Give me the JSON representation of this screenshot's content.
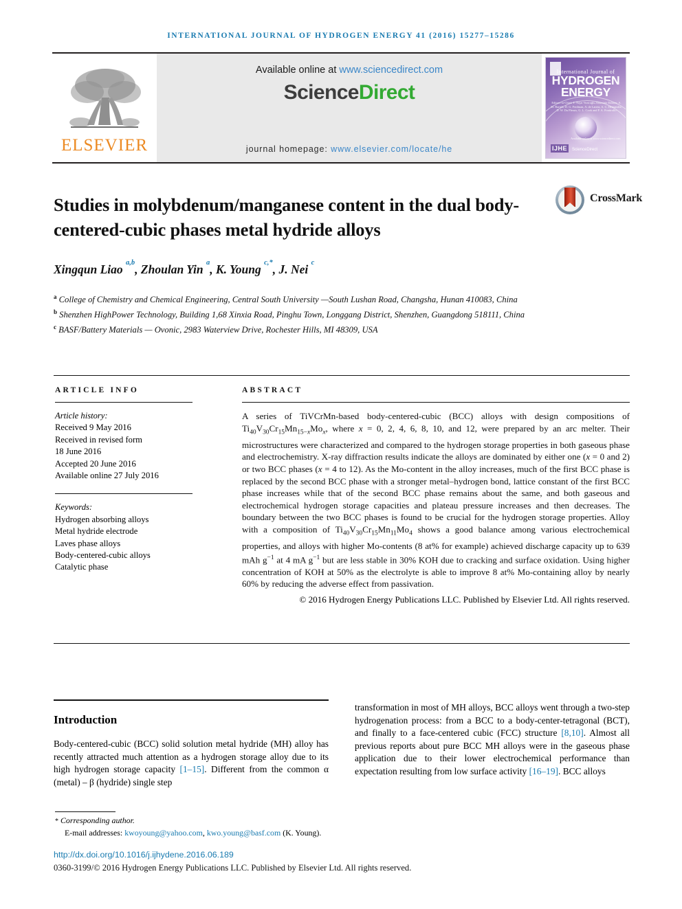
{
  "running_head": "International Journal of Hydrogen Energy 41 (2016) 15277–15286",
  "masthead": {
    "available_prefix": "Available online at ",
    "available_url": "www.sciencedirect.com",
    "logo_part1": "Science",
    "logo_part2": "Direct",
    "homepage_prefix": "journal homepage: ",
    "homepage_url": "www.elsevier.com/locate/he",
    "publisher_wordmark": "ELSEVIER",
    "cover": {
      "line1": "International Journal of",
      "line2": "HYDROGEN ENERGY",
      "editors": "Editors-in-Chief: T. Nejat Veziroğlu    Associate Editors: A. M. Bartels, D. G. Ferdman, A. de Larrea, A. C. Hernandez, D. W. Du Plessis, G. L. Cook and F. A. Pontirollo",
      "badge": "IJHE",
      "sciencedirect_mark": "ScienceDirect",
      "bottom_note": "Available online at www.sciencedirect.com"
    }
  },
  "article": {
    "title": "Studies in molybdenum/manganese content in the dual body-centered-cubic phases metal hydride alloys",
    "crossmark_label": "CrossMark",
    "authors_plain": "Xingqun Liao a,b, Zhoulan Yin a, K. Young c,*, J. Nei c",
    "affiliations": [
      "College of Chemistry and Chemical Engineering, Central South University —South Lushan Road, Changsha, Hunan 410083, China",
      "Shenzhen HighPower Technology, Building 1,68 Xinxia Road, Pinghu Town, Longgang District, Shenzhen, Guangdong 518111, China",
      "BASF/Battery Materials — Ovonic, 2983 Waterview Drive, Rochester Hills, MI 48309, USA"
    ]
  },
  "article_info": {
    "heading": "ARTICLE INFO",
    "history_label": "Article history:",
    "history": [
      "Received 9 May 2016",
      "Received in revised form",
      "18 June 2016",
      "Accepted 20 June 2016",
      "Available online 27 July 2016"
    ],
    "keywords_label": "Keywords:",
    "keywords": [
      "Hydrogen absorbing alloys",
      "Metal hydride electrode",
      "Laves phase alloys",
      "Body-centered-cubic alloys",
      "Catalytic phase"
    ]
  },
  "abstract": {
    "heading": "ABSTRACT",
    "copyright": "© 2016 Hydrogen Energy Publications LLC. Published by Elsevier Ltd. All rights reserved."
  },
  "body": {
    "intro_heading": "Introduction",
    "left_paragraph": "Body-centered-cubic (BCC) solid solution metal hydride (MH) alloy has recently attracted much attention as a hydrogen storage alloy due to its high hydrogen storage capacity [1–15]. Different from the common α (metal) – β (hydride) single step",
    "right_paragraph": "transformation in most of MH alloys, BCC alloys went through a two-step hydrogenation process: from a BCC to a body-center-tetragonal (BCT), and finally to a face-centered cubic (FCC) structure [8,10]. Almost all previous reports about pure BCC MH alloys were in the gaseous phase application due to their lower electrochemical performance than expectation resulting from low surface activity [16–19]. BCC alloys"
  },
  "footer": {
    "corresponding": "Corresponding author.",
    "email_label": "E-mail addresses:",
    "email1": "kwoyoung@yahoo.com",
    "email2": "kwo.young@basf.com",
    "email_owner": "(K. Young).",
    "doi": "http://dx.doi.org/10.1016/j.ijhydene.2016.06.189",
    "issn_line": "0360-3199/© 2016 Hydrogen Energy Publications LLC. Published by Elsevier Ltd. All rights reserved."
  },
  "colors": {
    "link": "#1a7bb0",
    "sciencedirect_green": "#33aa33",
    "elsevier_orange": "#ec8a23",
    "running_head": "#1a7bb0"
  }
}
